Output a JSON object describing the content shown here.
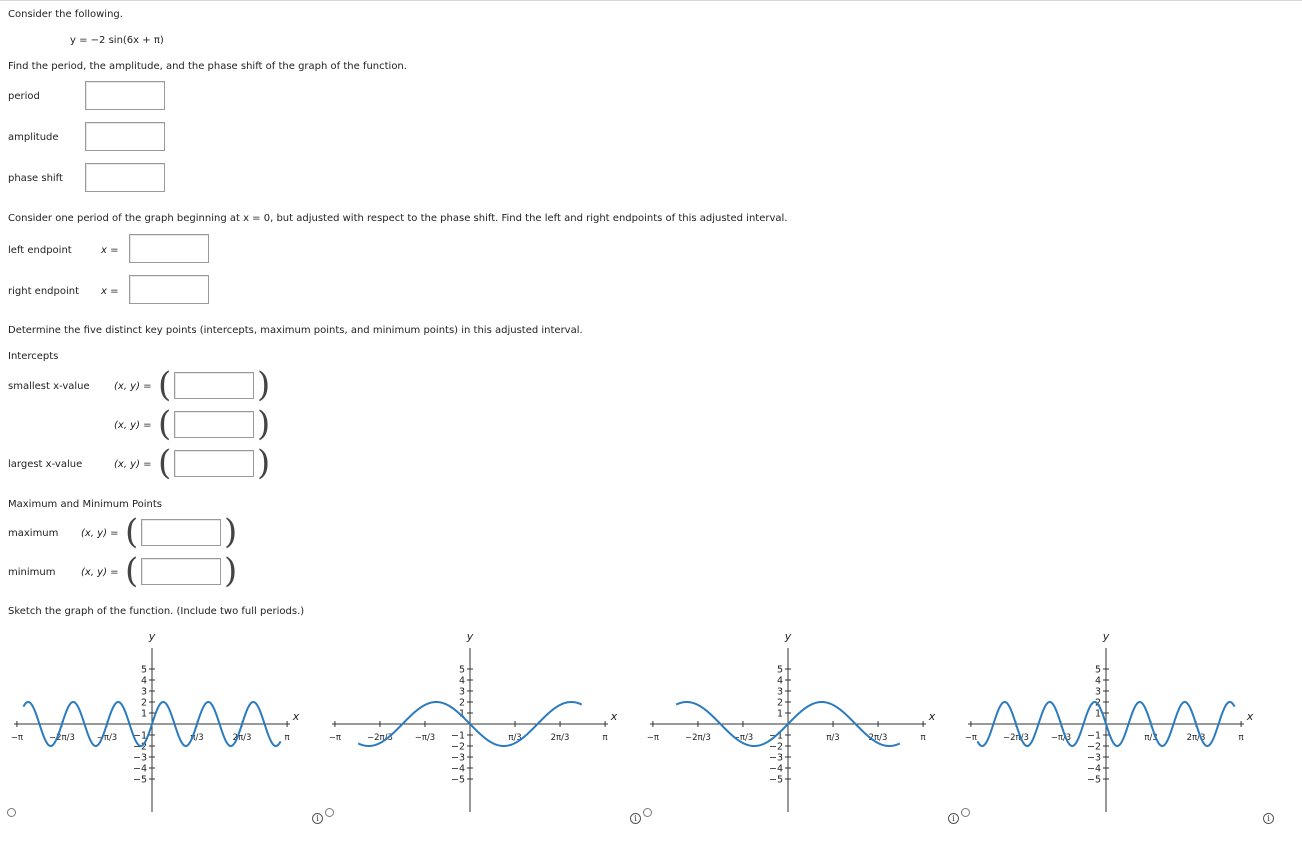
{
  "intro": "Consider the following.",
  "equation": "y = −2 sin(6x + π)",
  "q1": "Find the period, the amplitude, and the phase shift of the graph of the function.",
  "fields": {
    "period": "period",
    "amplitude": "amplitude",
    "phase_shift": "phase shift"
  },
  "q2": "Consider one period of the graph beginning at x = 0, but adjusted with respect to the phase shift. Find the left and right endpoints of this adjusted interval.",
  "endpoints": {
    "left_label": "left endpoint",
    "right_label": "right endpoint",
    "x_eq": "x  ="
  },
  "q3": "Determine the five distinct key points (intercepts, maximum points, and minimum points) in this adjusted interval.",
  "intercepts": {
    "heading": "Intercepts",
    "smallest": "smallest x-value",
    "largest": "largest x-value",
    "xy_eq": "(x, y)  ="
  },
  "maxmin": {
    "heading": "Maximum and Minimum Points",
    "maximum": "maximum",
    "minimum": "minimum",
    "xy_eq": "(x, y)  ="
  },
  "sketch": "Sketch the graph of the function. (Include two full periods.)",
  "icons": {
    "info": "info-icon",
    "radio": "radio-button"
  },
  "colors": {
    "curve": "#2b7bbf",
    "axis": "#333333",
    "input_border": "#9a9a9a"
  },
  "graphs": [
    {
      "type": "line",
      "ylabel": "y",
      "xlabel": "x",
      "y_ticks": [
        "5",
        "4",
        "3",
        "2",
        "1",
        "−1",
        "−2",
        "−3",
        "−4",
        "−5"
      ],
      "x_ticks": [
        "−π",
        "−2π/3",
        "−π/3",
        "π/3",
        "2π/3",
        "π"
      ],
      "x_range": [
        -3.1416,
        3.1416
      ],
      "y_range": [
        -5,
        5
      ],
      "curve": {
        "amplitude": 2,
        "frequency": 6,
        "phase": 0,
        "sign": 1
      },
      "curve_domain": [
        -2.99,
        2.99
      ]
    },
    {
      "type": "line",
      "ylabel": "y",
      "xlabel": "x",
      "y_ticks": [
        "5",
        "4",
        "3",
        "2",
        "1",
        "−1",
        "−2",
        "−3",
        "−4",
        "−5"
      ],
      "x_ticks": [
        "−π",
        "−2π/3",
        "−π/3",
        "π/3",
        "2π/3",
        "π"
      ],
      "x_range": [
        -3.1416,
        3.1416
      ],
      "y_range": [
        -5,
        5
      ],
      "curve": {
        "amplitude": 2,
        "frequency": 2,
        "phase": 0,
        "sign": -1
      },
      "curve_domain": [
        -2.6,
        2.6
      ]
    },
    {
      "type": "line",
      "ylabel": "y",
      "xlabel": "x",
      "y_ticks": [
        "5",
        "4",
        "3",
        "2",
        "1",
        "−1",
        "−2",
        "−3",
        "−4",
        "−5"
      ],
      "x_ticks": [
        "−π",
        "−2π/3",
        "−π/3",
        "π/3",
        "2π/3",
        "π"
      ],
      "x_range": [
        -3.1416,
        3.1416
      ],
      "y_range": [
        -5,
        5
      ],
      "curve": {
        "amplitude": 2,
        "frequency": 2,
        "phase": 0,
        "sign": 1
      },
      "curve_domain": [
        -2.6,
        2.6
      ]
    },
    {
      "type": "line",
      "ylabel": "y",
      "xlabel": "x",
      "y_ticks": [
        "5",
        "4",
        "3",
        "2",
        "1",
        "−1",
        "−2",
        "−3",
        "−4",
        "−5"
      ],
      "x_ticks": [
        "−π",
        "−2π/3",
        "−π/3",
        "π/3",
        "2π/3",
        "π"
      ],
      "x_range": [
        -3.1416,
        3.1416
      ],
      "y_range": [
        -5,
        5
      ],
      "curve": {
        "amplitude": 2,
        "frequency": 6,
        "phase": 0,
        "sign": -1
      },
      "curve_domain": [
        -2.99,
        2.99
      ]
    }
  ]
}
